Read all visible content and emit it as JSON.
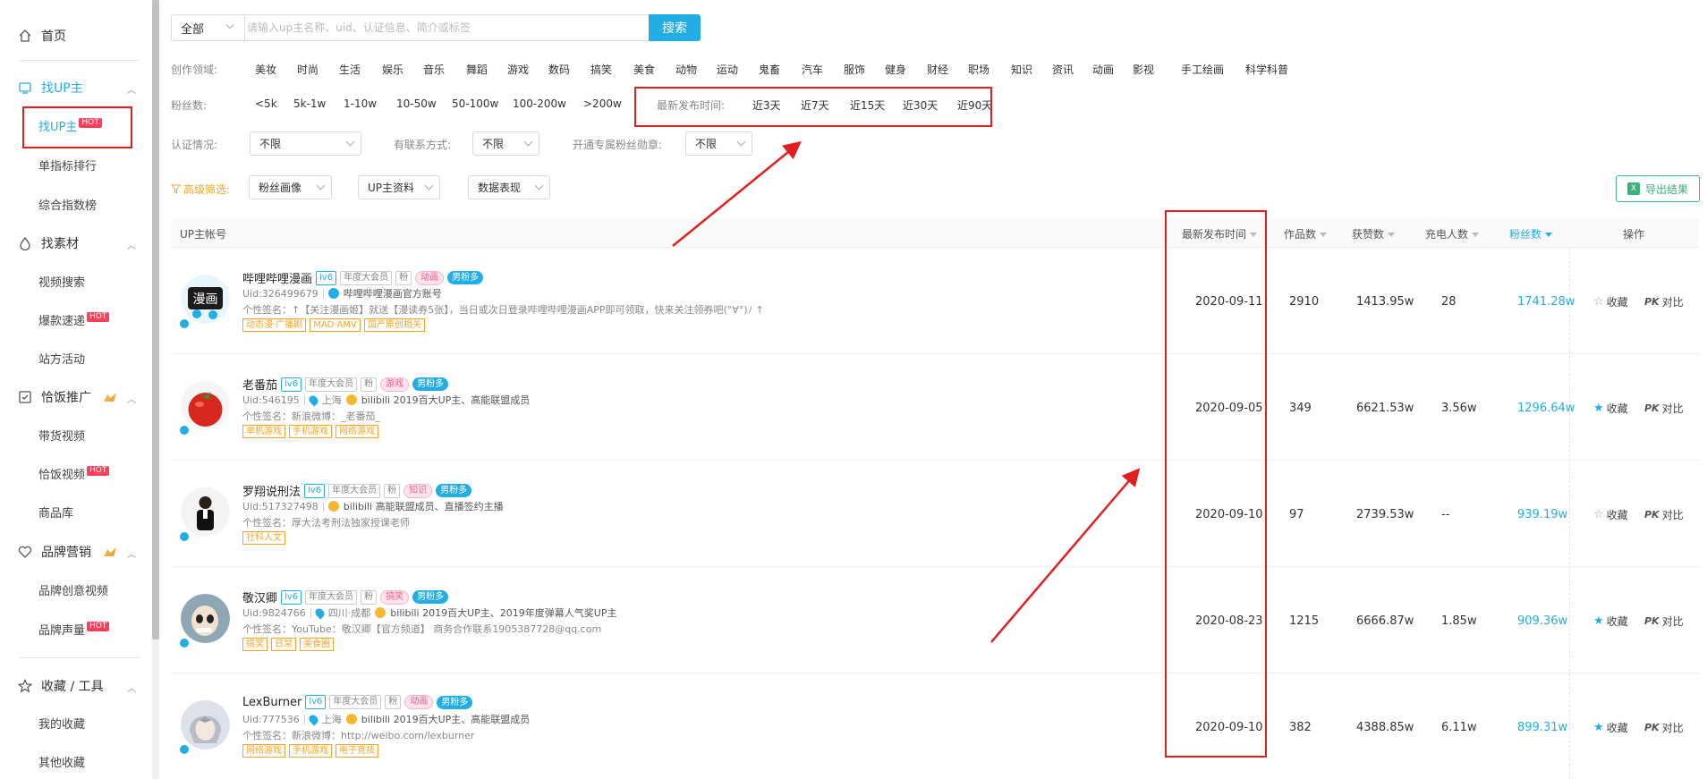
{
  "sidebar": {
    "home": "首页",
    "groups": [
      {
        "label": "找UP主",
        "items": [
          {
            "label": "找UP主",
            "hot": "HOT"
          },
          {
            "label": "单指标排行"
          },
          {
            "label": "综合指数榜"
          }
        ]
      },
      {
        "label": "找素材",
        "items": [
          {
            "label": "视频搜索"
          },
          {
            "label": "爆款速递",
            "hot": "HOT"
          },
          {
            "label": "站方活动"
          }
        ]
      },
      {
        "label": "恰饭推广",
        "items": [
          {
            "label": "带货视频"
          },
          {
            "label": "恰饭视频",
            "hot": "HOT"
          },
          {
            "label": "商品库"
          }
        ]
      },
      {
        "label": "品牌营销",
        "items": [
          {
            "label": "品牌创意视频"
          },
          {
            "label": "品牌声量",
            "hot": "HOT"
          }
        ]
      },
      {
        "label": "收藏 / 工具",
        "items": [
          {
            "label": "我的收藏"
          },
          {
            "label": "其他收藏"
          }
        ]
      }
    ]
  },
  "search": {
    "scope": "全部",
    "placeholder": "请输入up主名称、uid、认证信息、简介或标签",
    "button": "搜索"
  },
  "filters": {
    "domain_label": "创作领域:",
    "domains": [
      "美妆",
      "时尚",
      "生活",
      "娱乐",
      "音乐",
      "舞蹈",
      "游戏",
      "数码",
      "搞笑",
      "美食",
      "动物",
      "运动",
      "鬼畜",
      "汽车",
      "服饰",
      "健身",
      "财经",
      "职场",
      "知识",
      "资讯",
      "动画",
      "影视",
      "手工绘画",
      "科学科普"
    ],
    "fans_label": "粉丝数:",
    "fans": [
      "<5k",
      "5k-1w",
      "1-10w",
      "10-50w",
      "50-100w",
      "100-200w",
      ">200w"
    ],
    "recent_label": "最新发布时间:",
    "recent": [
      "近3天",
      "近7天",
      "近15天",
      "近30天",
      "近90天"
    ],
    "cert_label": "认证情况:",
    "cert_value": "不限",
    "contact_label": "有联系方式:",
    "contact_value": "不限",
    "exclusive_label": "开通专属粉丝勋章:",
    "exclusive_value": "不限",
    "advanced_label": "高级筛选:",
    "advanced": [
      "粉丝画像",
      "UP主资料",
      "数据表现"
    ],
    "export": "导出结果"
  },
  "table": {
    "headers": {
      "up": "UP主帐号",
      "recent": "最新发布时间",
      "works": "作品数",
      "likes": "获赞数",
      "charge": "充电人数",
      "fans": "粉丝数",
      "ops": "操作"
    },
    "rows": [
      {
        "name": "哔哩哔哩漫画",
        "lv": "lv6",
        "vip": "年度大会员",
        "fan": "粉",
        "cat": "动画",
        "gender": "男粉多",
        "uid": "Uid:326499679",
        "location": "",
        "cert": "哔哩哔哩漫画官方账号",
        "sig": "个性签名：↑【关注漫画姬】就送【漫读券5张】，当日或次日登录哔哩哔哩漫画APP即可领取，快来关注领券吧(°∀°)ﾉ ↑",
        "tags": [
          "动态漫·广播剧",
          "MAD·AMV",
          "国产原创相关"
        ],
        "date": "2020-09-11",
        "works": "2910",
        "likes": "1413.95w",
        "charge": "28",
        "fans": "1741.28w",
        "fav": "收藏",
        "pk": "PK",
        "compare": "对比",
        "faved": false
      },
      {
        "name": "老番茄",
        "lv": "lv6",
        "vip": "年度大会员",
        "fan": "粉",
        "cat": "游戏",
        "gender": "男粉多",
        "uid": "Uid:546195",
        "location": "上海",
        "cert": "bilibili 2019百大UP主、高能联盟成员",
        "sig": "个性签名：新浪微博：_老番茄_",
        "tags": [
          "单机游戏",
          "手机游戏",
          "网络游戏"
        ],
        "date": "2020-09-05",
        "works": "349",
        "likes": "6621.53w",
        "charge": "3.56w",
        "fans": "1296.64w",
        "fav": "收藏",
        "pk": "PK",
        "compare": "对比",
        "faved": true
      },
      {
        "name": "罗翔说刑法",
        "lv": "lv6",
        "vip": "年度大会员",
        "fan": "粉",
        "cat": "知识",
        "gender": "男粉多",
        "uid": "Uid:517327498",
        "location": "",
        "cert": "bilibili 高能联盟成员、直播签约主播",
        "sig": "个性签名：厚大法考刑法独家授课老师",
        "tags": [
          "社科人文"
        ],
        "date": "2020-09-10",
        "works": "97",
        "likes": "2739.53w",
        "charge": "--",
        "fans": "939.19w",
        "fav": "收藏",
        "pk": "PK",
        "compare": "对比",
        "faved": false
      },
      {
        "name": "敬汉卿",
        "lv": "lv6",
        "vip": "年度大会员",
        "fan": "粉",
        "cat": "搞笑",
        "gender": "男粉多",
        "uid": "Uid:9824766",
        "location": "四川·成都",
        "cert": "bilibili 2019百大UP主、2019年度弹幕人气奖UP主",
        "sig": "个性签名：YouTube：敬汉卿【官方频道】 商务合作联系1905387728@qq.com",
        "tags": [
          "搞笑",
          "日常",
          "美食圈"
        ],
        "date": "2020-08-23",
        "works": "1215",
        "likes": "6666.87w",
        "charge": "1.85w",
        "fans": "909.36w",
        "fav": "收藏",
        "pk": "PK",
        "compare": "对比",
        "faved": true
      },
      {
        "name": "LexBurner",
        "lv": "lv6",
        "vip": "年度大会员",
        "fan": "粉",
        "cat": "动画",
        "gender": "男粉多",
        "uid": "Uid:777536",
        "location": "上海",
        "cert": "bilibili 2019百大UP主、高能联盟成员",
        "sig": "个性签名：新浪微博：http://weibo.com/lexburner",
        "tags": [
          "网络游戏",
          "手机游戏",
          "电子竞技"
        ],
        "date": "2020-09-10",
        "works": "382",
        "likes": "4388.85w",
        "charge": "6.11w",
        "fans": "899.31w",
        "fav": "收藏",
        "pk": "PK",
        "compare": "对比",
        "faved": true
      }
    ]
  },
  "colors": {
    "accent": "#23ade5",
    "annotation": "#e02020",
    "hot": "#ff3f5a",
    "tag_orange": "#f5a623",
    "export_green": "#3bb07a"
  }
}
